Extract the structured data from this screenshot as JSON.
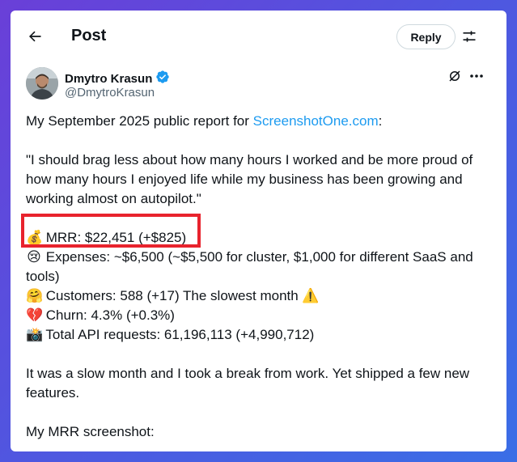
{
  "header": {
    "title": "Post",
    "reply_label": "Reply"
  },
  "author": {
    "name": "Dmytro Krasun",
    "handle": "@DmytroKrasun"
  },
  "post": {
    "intro": "My September 2025 public report for ",
    "link": "ScreenshotOne.com",
    "intro_end": ":",
    "quote": "\"I should brag less about how many hours I worked and be more proud of how many hours I enjoyed life while my business has been growing and working almost on autopilot.\"",
    "metrics": [
      {
        "icon": "💰",
        "text": "MRR: $22,451 (+$825)"
      },
      {
        "icon": "😢",
        "text": "Expenses: ~$6,500 (~$5,500 for cluster, $1,000 for different SaaS and tools)"
      },
      {
        "icon": "🤗",
        "text": "Customers:  588 (+17) The slowest month ⚠️"
      },
      {
        "icon": "💔",
        "text": "Churn: 4.3% (+0.3%)"
      },
      {
        "icon": "📸",
        "text": "Total API requests:  61,196,113 (+4,990,712)"
      }
    ],
    "closing": "It was a slow month and I took a break from work. Yet shipped a few new features.",
    "screenshot_label": "My MRR screenshot:"
  },
  "colors": {
    "accent": "#1d9bf0",
    "highlight": "#e8232d",
    "verified": "#1d9bf0"
  }
}
